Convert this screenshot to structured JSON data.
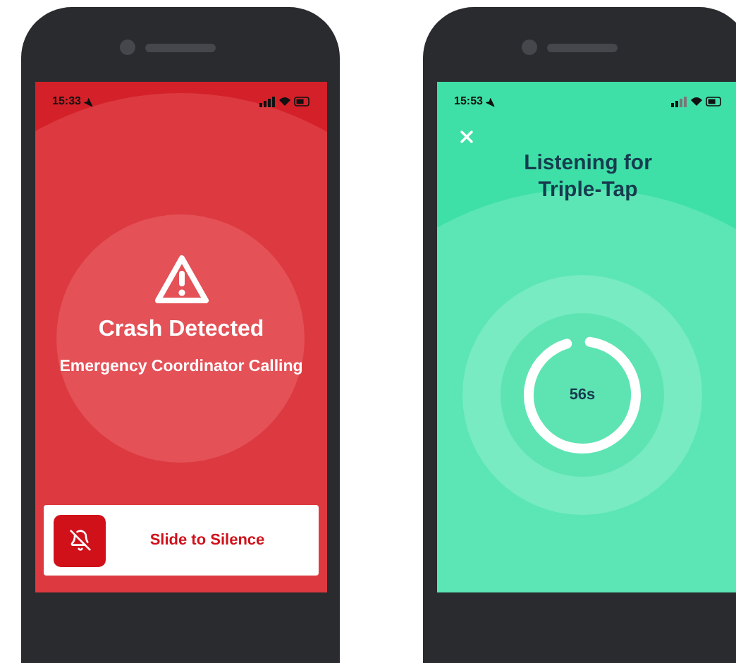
{
  "phones": [
    {
      "kind": "alert",
      "status_time": "15:33",
      "title": "Crash Detected",
      "subtitle": "Emergency Coordinator Calling",
      "slider": {
        "label": "Slide to Silence",
        "level": 0
      }
    },
    {
      "kind": "listening",
      "status_time": "15:53",
      "title": "Listening for Triple-Tap",
      "timer": {
        "label": "56s",
        "level": 0.93
      }
    }
  ]
}
